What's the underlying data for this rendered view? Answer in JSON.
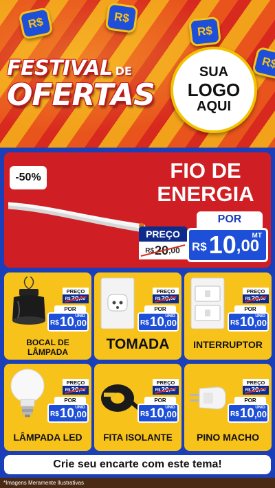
{
  "header": {
    "coins": [
      "R$",
      "R$",
      "R$",
      "R$"
    ],
    "festival_line1": "FESTIVAL",
    "festival_de": "DE",
    "festival_line2": "OFERTAS",
    "logo_line1": "SUA",
    "logo_line2": "LOGO",
    "logo_line3": "AQUI"
  },
  "featured": {
    "discount": "-50%",
    "title_line1": "FIO DE",
    "title_line2": "ENERGIA",
    "old_label": "PREÇO",
    "old_currency": "R$",
    "old_int": "20",
    "old_dec": ",00",
    "por_label": "POR",
    "new_currency": "R$",
    "new_int": "10",
    "new_dec": ",00",
    "unit": "MT"
  },
  "products": [
    {
      "name_line1": "BOCAL DE",
      "name_line2": "LÂMPADA",
      "icon": "socket-icon",
      "old_label": "PREÇO",
      "old_currency": "R$",
      "old_int": "20",
      "old_dec": ",00",
      "por_label": "POR",
      "new_currency": "R$",
      "new_int": "10",
      "new_dec": ",00",
      "unit": "UNID"
    },
    {
      "name_line1": "TOMADA",
      "icon": "outlet-icon",
      "old_label": "PREÇO",
      "old_currency": "R$",
      "old_int": "20",
      "old_dec": ",00",
      "por_label": "POR",
      "new_currency": "R$",
      "new_int": "10",
      "new_dec": ",00",
      "unit": "UNID"
    },
    {
      "name_line1": "INTERRUPTOR",
      "icon": "switch-icon",
      "old_label": "PREÇO",
      "old_currency": "R$",
      "old_int": "20",
      "old_dec": ",00",
      "por_label": "POR",
      "new_currency": "R$",
      "new_int": "10",
      "new_dec": ",00",
      "unit": "UNID"
    },
    {
      "name_line1": "LÂMPADA LED",
      "icon": "led-bulb-icon",
      "old_label": "PREÇO",
      "old_currency": "R$",
      "old_int": "20",
      "old_dec": ",00",
      "por_label": "POR",
      "new_currency": "R$",
      "new_int": "10",
      "new_dec": ",00",
      "unit": "UNID"
    },
    {
      "name_line1": "FITA ISOLANTE",
      "icon": "tape-icon",
      "old_label": "PREÇO",
      "old_currency": "R$",
      "old_int": "20",
      "old_dec": ",00",
      "por_label": "POR",
      "new_currency": "R$",
      "new_int": "10",
      "new_dec": ",00",
      "unit": "UNID"
    },
    {
      "name_line1": "PINO MACHO",
      "icon": "plug-icon",
      "old_label": "PREÇO",
      "old_currency": "R$",
      "old_int": "20",
      "old_dec": ",00",
      "por_label": "POR",
      "new_currency": "R$",
      "new_int": "10",
      "new_dec": ",00",
      "unit": "UNID"
    }
  ],
  "cta": "Crie seu encarte com este tema!",
  "disclaimer": "*Imagens Meramente Ilustrativas",
  "colors": {
    "blue": "#1d4fd8",
    "dark_blue": "#0d2b8c",
    "red": "#cf1f24",
    "yellow": "#f7c21a"
  }
}
